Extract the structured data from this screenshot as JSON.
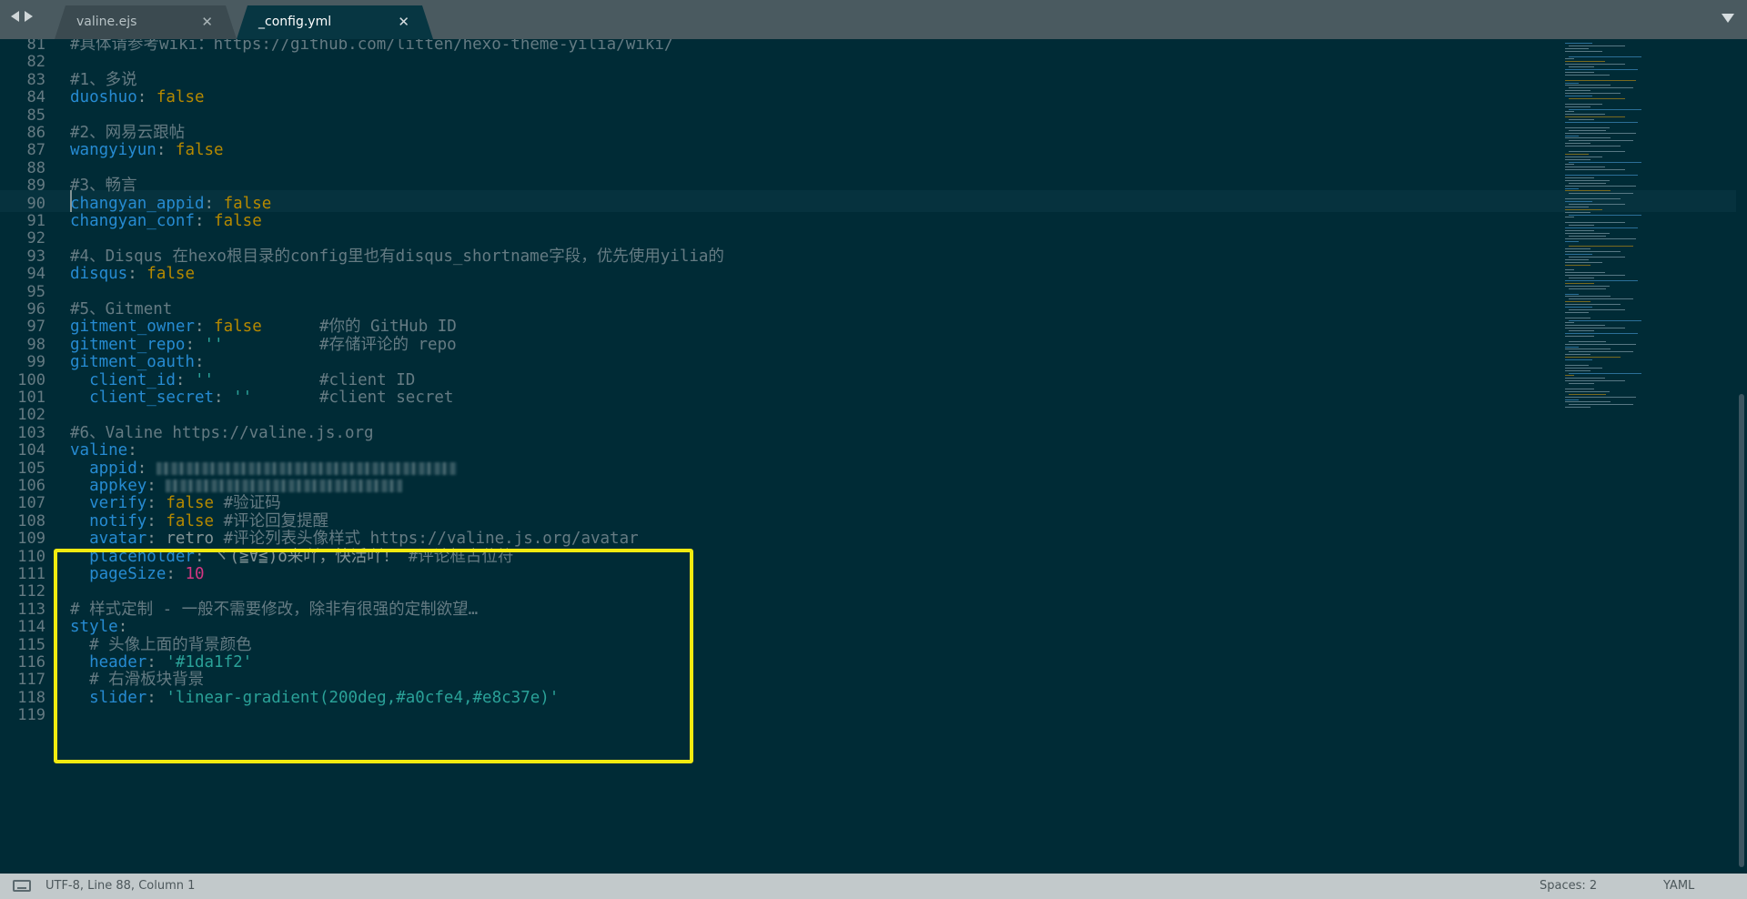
{
  "tabs": [
    {
      "label": "valine.ejs",
      "close": "✕",
      "active": false
    },
    {
      "label": "_config.yml",
      "close": "✕",
      "active": true
    }
  ],
  "editor": {
    "first_line_number": 81,
    "current_line": 88,
    "lines": [
      {
        "n": "81",
        "parts": [
          {
            "t": "#具体请参考wiki：https://github.com/litten/hexo-theme-yilia/wiki/",
            "c": "c"
          }
        ]
      },
      {
        "n": "82",
        "parts": []
      },
      {
        "n": "83",
        "parts": [
          {
            "t": "#1、多说",
            "c": "c"
          }
        ]
      },
      {
        "n": "84",
        "parts": [
          {
            "t": "duoshuo",
            "c": "k"
          },
          {
            "t": ": ",
            "c": "p"
          },
          {
            "t": "false",
            "c": "b"
          }
        ]
      },
      {
        "n": "85",
        "parts": []
      },
      {
        "n": "86",
        "parts": [
          {
            "t": "#2、网易云跟帖",
            "c": "c"
          }
        ]
      },
      {
        "n": "87",
        "parts": [
          {
            "t": "wangyiyun",
            "c": "k"
          },
          {
            "t": ": ",
            "c": "p"
          },
          {
            "t": "false",
            "c": "b"
          }
        ]
      },
      {
        "n": "88",
        "parts": []
      },
      {
        "n": "89",
        "parts": [
          {
            "t": "#3、畅言",
            "c": "c"
          }
        ]
      },
      {
        "n": "90",
        "parts": [
          {
            "t": "changyan_appid",
            "c": "k"
          },
          {
            "t": ": ",
            "c": "p"
          },
          {
            "t": "false",
            "c": "b"
          }
        ]
      },
      {
        "n": "91",
        "parts": [
          {
            "t": "changyan_conf",
            "c": "k"
          },
          {
            "t": ": ",
            "c": "p"
          },
          {
            "t": "false",
            "c": "b"
          }
        ]
      },
      {
        "n": "92",
        "parts": []
      },
      {
        "n": "93",
        "parts": [
          {
            "t": "#4、Disqus 在hexo根目录的config里也有disqus_shortname字段，优先使用yilia的",
            "c": "c"
          }
        ]
      },
      {
        "n": "94",
        "parts": [
          {
            "t": "disqus",
            "c": "k"
          },
          {
            "t": ": ",
            "c": "p"
          },
          {
            "t": "false",
            "c": "b"
          }
        ]
      },
      {
        "n": "95",
        "parts": []
      },
      {
        "n": "96",
        "parts": [
          {
            "t": "#5、Gitment",
            "c": "c"
          }
        ]
      },
      {
        "n": "97",
        "parts": [
          {
            "t": "gitment_owner",
            "c": "k"
          },
          {
            "t": ": ",
            "c": "p"
          },
          {
            "t": "false",
            "c": "b"
          },
          {
            "t": "      #你的 GitHub ID",
            "c": "c"
          }
        ]
      },
      {
        "n": "98",
        "parts": [
          {
            "t": "gitment_repo",
            "c": "k"
          },
          {
            "t": ": ",
            "c": "p"
          },
          {
            "t": "''",
            "c": "s"
          },
          {
            "t": "          #存储评论的 repo",
            "c": "c"
          }
        ]
      },
      {
        "n": "99",
        "parts": [
          {
            "t": "gitment_oauth",
            "c": "k"
          },
          {
            "t": ":",
            "c": "p"
          }
        ]
      },
      {
        "n": "100",
        "parts": [
          {
            "t": "  client_id",
            "c": "k"
          },
          {
            "t": ": ",
            "c": "p"
          },
          {
            "t": "''",
            "c": "s"
          },
          {
            "t": "           #client ID",
            "c": "c"
          }
        ]
      },
      {
        "n": "101",
        "parts": [
          {
            "t": "  client_secret",
            "c": "k"
          },
          {
            "t": ": ",
            "c": "p"
          },
          {
            "t": "''",
            "c": "s"
          },
          {
            "t": "       #client secret",
            "c": "c"
          }
        ]
      },
      {
        "n": "102",
        "parts": []
      },
      {
        "n": "103",
        "parts": [
          {
            "t": "#6、Valine https://valine.js.org",
            "c": "c"
          }
        ]
      },
      {
        "n": "104",
        "parts": [
          {
            "t": "valine",
            "c": "k"
          },
          {
            "t": ":",
            "c": "p"
          }
        ]
      },
      {
        "n": "105",
        "parts": [
          {
            "t": "  appid",
            "c": "k"
          },
          {
            "t": ": ",
            "c": "p"
          },
          {
            "blur": 330
          }
        ]
      },
      {
        "n": "106",
        "parts": [
          {
            "t": "  appkey",
            "c": "k"
          },
          {
            "t": ": ",
            "c": "p"
          },
          {
            "blur": 260
          }
        ]
      },
      {
        "n": "107",
        "parts": [
          {
            "t": "  verify",
            "c": "k"
          },
          {
            "t": ": ",
            "c": "p"
          },
          {
            "t": "false",
            "c": "b"
          },
          {
            "t": " #验证码",
            "c": "c"
          }
        ]
      },
      {
        "n": "108",
        "parts": [
          {
            "t": "  notify",
            "c": "k"
          },
          {
            "t": ": ",
            "c": "p"
          },
          {
            "t": "false",
            "c": "b"
          },
          {
            "t": " #评论回复提醒",
            "c": "c"
          }
        ]
      },
      {
        "n": "109",
        "parts": [
          {
            "t": "  avatar",
            "c": "k"
          },
          {
            "t": ": ",
            "c": "p"
          },
          {
            "t": "retro ",
            "c": "p"
          },
          {
            "t": "#评论列表头像样式 https://valine.js.org/avatar",
            "c": "c"
          }
        ]
      },
      {
        "n": "110",
        "parts": [
          {
            "t": "  placeholder",
            "c": "k"
          },
          {
            "t": ": ",
            "c": "p"
          },
          {
            "t": "ヾ(≧∀≦)o来吖，快活吖！ ",
            "c": "p"
          },
          {
            "t": "#评论框占位符",
            "c": "c"
          }
        ]
      },
      {
        "n": "111",
        "parts": [
          {
            "t": "  pageSize",
            "c": "k"
          },
          {
            "t": ": ",
            "c": "p"
          },
          {
            "t": "10",
            "c": "n"
          }
        ]
      },
      {
        "n": "112",
        "parts": []
      },
      {
        "n": "113",
        "parts": [
          {
            "t": "# 样式定制 - 一般不需要修改，除非有很强的定制欲望…",
            "c": "c"
          }
        ]
      },
      {
        "n": "114",
        "parts": [
          {
            "t": "style",
            "c": "k"
          },
          {
            "t": ":",
            "c": "p"
          }
        ]
      },
      {
        "n": "115",
        "parts": [
          {
            "t": "  # 头像上面的背景颜色",
            "c": "c"
          }
        ]
      },
      {
        "n": "116",
        "parts": [
          {
            "t": "  header",
            "c": "k"
          },
          {
            "t": ": ",
            "c": "p"
          },
          {
            "t": "'#1da1f2'",
            "c": "s"
          }
        ]
      },
      {
        "n": "117",
        "parts": [
          {
            "t": "  # 右滑板块背景",
            "c": "c"
          }
        ]
      },
      {
        "n": "118",
        "parts": [
          {
            "t": "  slider",
            "c": "k"
          },
          {
            "t": ": ",
            "c": "p"
          },
          {
            "t": "'linear-gradient(200deg,#a0cfe4,#e8c37e)'",
            "c": "s"
          }
        ]
      },
      {
        "n": "119",
        "parts": []
      }
    ]
  },
  "status": {
    "position": "UTF-8, Line 88, Column 1",
    "spaces": "Spaces: 2",
    "syntax": "YAML"
  },
  "colors": {
    "background": "#002b36",
    "key": "#268bd2",
    "boolean": "#b58900",
    "comment": "#657b83",
    "string": "#2aa198",
    "number": "#d33682",
    "highlight_box": "#f2ea10"
  }
}
